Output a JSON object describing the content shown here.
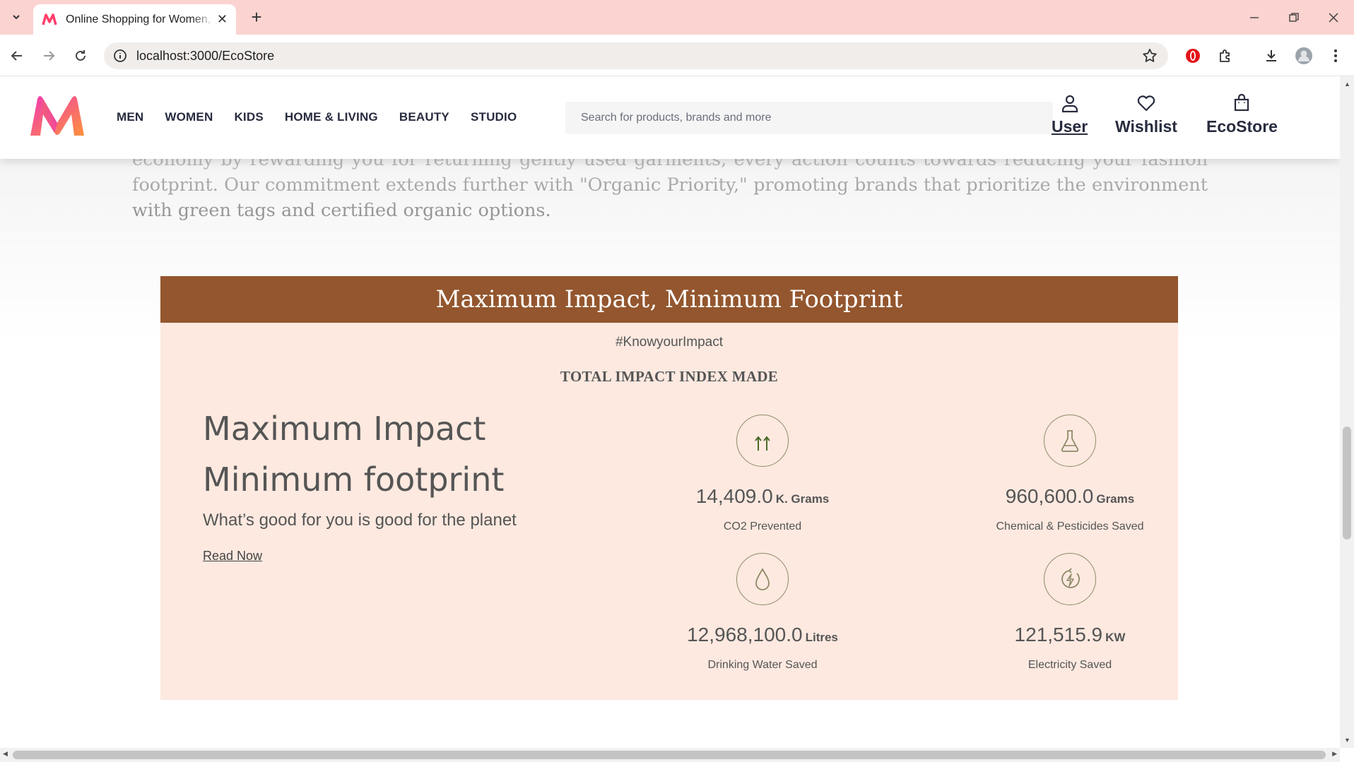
{
  "browser": {
    "tab_title": "Online Shopping for Women, Men, Kids",
    "url": "localhost:3000/EcoStore"
  },
  "header": {
    "nav": [
      "MEN",
      "WOMEN",
      "KIDS",
      "HOME & LIVING",
      "BEAUTY",
      "STUDIO"
    ],
    "search_placeholder": "Search for products, brands and more",
    "actions": {
      "user": "User",
      "wishlist": "Wishlist",
      "ecostore": "EcoStore"
    }
  },
  "intro": {
    "text": "economy by rewarding you for returning gently used garments, every action counts towards reducing your fashion footprint. Our commitment extends further with \"Organic Priority,\" promoting brands that prioritize the environment with green tags and certified organic options."
  },
  "impact": {
    "header": "Maximum Impact, Minimum Footprint",
    "hashtag": "#KnowyourImpact",
    "index_title": "TOTAL IMPACT INDEX MADE",
    "lead_line1": "Maximum Impact",
    "lead_line2": "Minimum footprint",
    "lead_sub": "What’s good for you is good for the planet",
    "read_now": "Read Now",
    "stats": [
      {
        "icon": "co2-arrows-icon",
        "value": "14,409.0",
        "unit": "K. Grams",
        "label": "CO2 Prevented"
      },
      {
        "icon": "flask-icon",
        "value": "960,600.0",
        "unit": "Grams",
        "label": "Chemical & Pesticides Saved"
      },
      {
        "icon": "water-drop-icon",
        "value": "12,968,100.0",
        "unit": "Litres",
        "label": "Drinking Water Saved"
      },
      {
        "icon": "electricity-icon",
        "value": "121,515.9",
        "unit": "KW",
        "label": "Electricity Saved"
      }
    ]
  },
  "colors": {
    "impact_header_bg": "#93562e",
    "impact_card_bg": "#fde9e0",
    "tabbar_bg": "#fbd3d0"
  }
}
